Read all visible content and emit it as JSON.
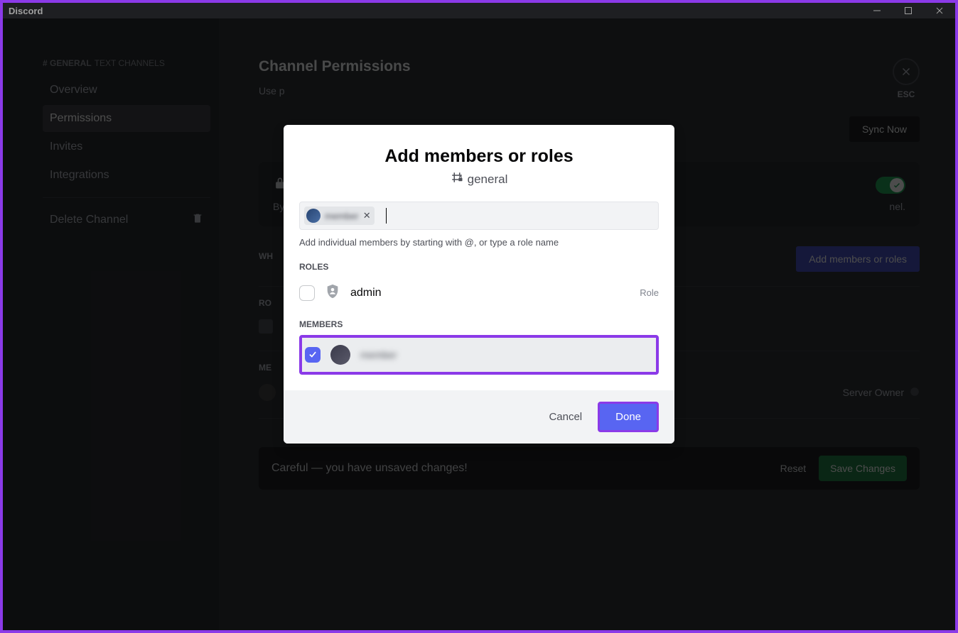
{
  "window": {
    "title": "Discord"
  },
  "sidebar": {
    "channel_prefix": "# GENERAL",
    "channel_type": "TEXT CHANNELS",
    "items": [
      {
        "label": "Overview"
      },
      {
        "label": "Permissions"
      },
      {
        "label": "Invites"
      },
      {
        "label": "Integrations"
      }
    ],
    "delete_label": "Delete Channel"
  },
  "main": {
    "title": "Channel Permissions",
    "desc": "Use p",
    "sync_button": "Sync Now",
    "private_desc": "By",
    "private_trailing": "nel.",
    "who_label": "WH",
    "add_members_btn": "Add members or roles",
    "roles_label": "RO",
    "members_label": "ME",
    "server_owner": "Server Owner",
    "close_label": "ESC",
    "changes_warning": "Careful — you have unsaved changes!",
    "reset_label": "Reset",
    "save_label": "Save Changes"
  },
  "modal": {
    "title": "Add members or roles",
    "channel_name": "general",
    "chip_name": "member",
    "hint": "Add individual members by starting with @, or type a role name",
    "roles_label": "ROLES",
    "role_items": [
      {
        "name": "admin",
        "type": "Role",
        "checked": false
      }
    ],
    "members_label": "MEMBERS",
    "member_items": [
      {
        "name": "member",
        "checked": true
      }
    ],
    "cancel": "Cancel",
    "done": "Done"
  }
}
